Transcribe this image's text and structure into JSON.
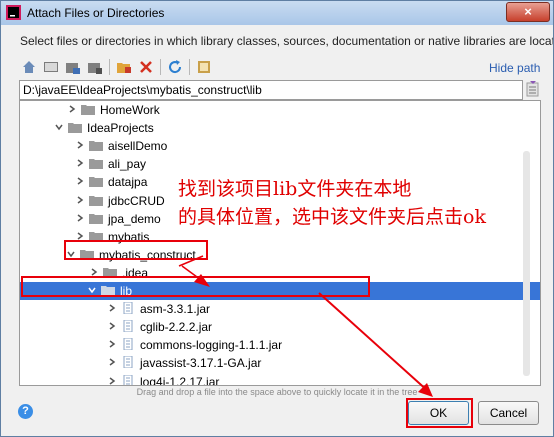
{
  "window": {
    "title": "Attach Files or Directories",
    "close_glyph": "×"
  },
  "description": "Select files or directories in which library classes, sources, documentation or native libraries are located",
  "toolbar": {
    "hide_path": "Hide path"
  },
  "path": "D:\\javaEE\\IdeaProjects\\mybatis_construct\\lib",
  "tree": [
    {
      "label": "HomeWork",
      "expanded": false,
      "selected": false
    },
    {
      "label": "IdeaProjects",
      "expanded": true,
      "selected": false
    },
    {
      "label": "aisellDemo",
      "expanded": false,
      "selected": false
    },
    {
      "label": "ali_pay",
      "expanded": false,
      "selected": false
    },
    {
      "label": "datajpa",
      "expanded": false,
      "selected": false
    },
    {
      "label": "jdbcCRUD",
      "expanded": false,
      "selected": false
    },
    {
      "label": "jpa_demo",
      "expanded": false,
      "selected": false
    },
    {
      "label": "mybatis",
      "expanded": false,
      "selected": false
    },
    {
      "label": "mybatis_construct",
      "expanded": true,
      "selected": false
    },
    {
      "label": ".idea",
      "expanded": false,
      "selected": false
    },
    {
      "label": "lib",
      "expanded": true,
      "selected": true
    },
    {
      "label": "asm-3.3.1.jar",
      "expanded": false,
      "selected": false
    },
    {
      "label": "cglib-2.2.2.jar",
      "expanded": false,
      "selected": false
    },
    {
      "label": "commons-logging-1.1.1.jar",
      "expanded": false,
      "selected": false
    },
    {
      "label": "javassist-3.17.1-GA.jar",
      "expanded": false,
      "selected": false
    },
    {
      "label": "log4j-1.2.17.jar",
      "expanded": false,
      "selected": false
    }
  ],
  "hint": "Drag and drop a file into the space above to quickly locate it in the tree",
  "buttons": {
    "help": "?",
    "ok": "OK",
    "cancel": "Cancel"
  },
  "annotation": {
    "line1": "找到该项目lib文件夹在本地",
    "line2": "的具体位置，选中该文件夹后点击ok"
  },
  "colors": {
    "accent": "#3875d7",
    "annotation": "#e00000",
    "link": "#2a5db0"
  },
  "icons": {
    "toolbar": [
      "home-icon",
      "desktop-icon",
      "project-icon",
      "module-icon",
      "new-folder-icon",
      "delete-icon",
      "refresh-icon",
      "show-hidden-icon"
    ],
    "tree_folder": "folder-icon",
    "tree_file": "jar-file-icon"
  }
}
